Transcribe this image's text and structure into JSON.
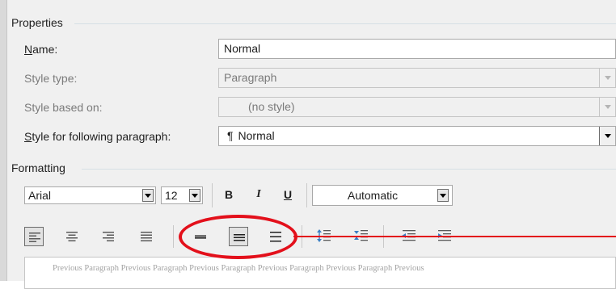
{
  "properties": {
    "group_label": "Properties",
    "name": {
      "label": "Name:",
      "value": "Normal"
    },
    "style_type": {
      "label": "Style type:",
      "value": "Paragraph"
    },
    "style_based_on": {
      "label": "Style based on:",
      "value": "(no style)"
    },
    "following": {
      "label": "Style for following paragraph:",
      "glyph": "¶",
      "value": "Normal"
    }
  },
  "formatting": {
    "group_label": "Formatting",
    "font": "Arial",
    "size": "12",
    "bold": "B",
    "italic": "I",
    "underline": "U",
    "color": "Automatic"
  },
  "preview": {
    "text": "Previous Paragraph Previous Paragraph Previous Paragraph Previous Paragraph Previous Paragraph Previous"
  },
  "annotation_color": "#e3101b",
  "icons": [
    "align-left-icon",
    "align-center-icon",
    "align-right-icon",
    "justify-icon",
    "single-spacing-icon",
    "one-half-spacing-icon",
    "double-spacing-icon",
    "increase-paragraph-spacing-icon",
    "decrease-paragraph-spacing-icon",
    "decrease-indent-icon",
    "increase-indent-icon"
  ]
}
